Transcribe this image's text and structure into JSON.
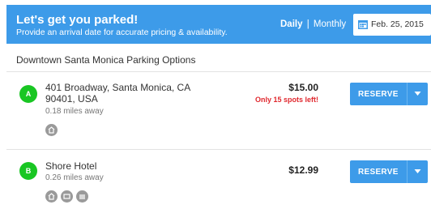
{
  "header": {
    "title": "Let's get you parked!",
    "subtitle": "Provide an arrival date for accurate pricing & availability.",
    "toggle_daily": "Daily",
    "toggle_separator": "|",
    "toggle_monthly": "Monthly",
    "date_value": "Feb. 25, 2015"
  },
  "section_title": "Downtown Santa Monica Parking Options",
  "listings": [
    {
      "marker": "A",
      "address_line1": "401 Broadway, Santa Monica, CA",
      "address_line2": "90401, USA",
      "distance": "0.18 miles away",
      "price": "$15.00",
      "availability": "Only 15 spots left!",
      "reserve_label": "RESERVE",
      "amenity_icons": [
        "covered-parking-icon"
      ]
    },
    {
      "marker": "B",
      "address_line1": "Shore Hotel",
      "distance": "0.26 miles away",
      "price": "$12.99",
      "reserve_label": "RESERVE",
      "amenity_icons": [
        "covered-parking-icon",
        "valet-icon",
        "garage-icon"
      ]
    }
  ],
  "colors": {
    "header_bg": "#3d9be9",
    "button_bg": "#3d9be9",
    "marker_green": "#19c623",
    "alert_red": "#e0282e"
  }
}
